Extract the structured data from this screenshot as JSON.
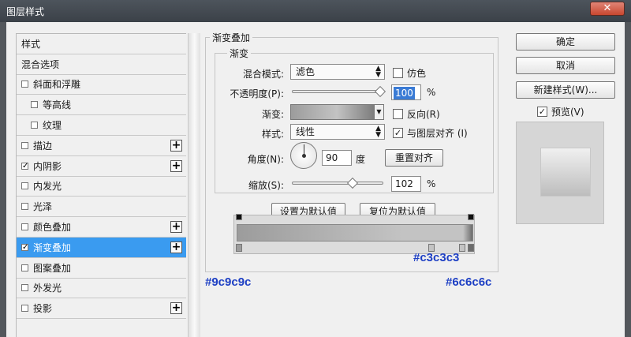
{
  "window": {
    "title": "图层样式",
    "close_label": "✕"
  },
  "left": {
    "items": [
      {
        "label": "样式",
        "checkbox": false,
        "sub": false,
        "plus": false
      },
      {
        "label": "混合选项",
        "checkbox": false,
        "sub": false,
        "plus": false
      },
      {
        "label": "斜面和浮雕",
        "checkbox": true,
        "checked": false,
        "sub": false,
        "plus": false
      },
      {
        "label": "等高线",
        "checkbox": true,
        "checked": false,
        "sub": true,
        "plus": false
      },
      {
        "label": "纹理",
        "checkbox": true,
        "checked": false,
        "sub": true,
        "plus": false
      },
      {
        "label": "描边",
        "checkbox": true,
        "checked": false,
        "sub": false,
        "plus": true
      },
      {
        "label": "内阴影",
        "checkbox": true,
        "checked": true,
        "sub": false,
        "plus": true
      },
      {
        "label": "内发光",
        "checkbox": true,
        "checked": false,
        "sub": false,
        "plus": false
      },
      {
        "label": "光泽",
        "checkbox": true,
        "checked": false,
        "sub": false,
        "plus": false
      },
      {
        "label": "颜色叠加",
        "checkbox": true,
        "checked": false,
        "sub": false,
        "plus": true
      },
      {
        "label": "渐变叠加",
        "checkbox": true,
        "checked": true,
        "sub": false,
        "plus": true,
        "active": true
      },
      {
        "label": "图案叠加",
        "checkbox": true,
        "checked": false,
        "sub": false,
        "plus": false
      },
      {
        "label": "外发光",
        "checkbox": true,
        "checked": false,
        "sub": false,
        "plus": false
      },
      {
        "label": "投影",
        "checkbox": true,
        "checked": false,
        "sub": false,
        "plus": true
      }
    ]
  },
  "main": {
    "group_title": "渐变叠加",
    "subgroup_title": "渐变",
    "blend_mode_label": "混合模式:",
    "blend_mode_value": "滤色",
    "dither_label": "仿色",
    "opacity_label": "不透明度(P):",
    "opacity_value": "100",
    "opacity_percent": 100,
    "percent_sign": "%",
    "gradient_label": "渐变:",
    "reverse_label": "反向(R)",
    "style_label": "样式:",
    "style_value": "线性",
    "align_label": "与图层对齐 (I)",
    "angle_label": "角度(N):",
    "angle_value": "90",
    "degree_label": "度",
    "reset_align_label": "重置对齐",
    "scale_label": "缩放(S):",
    "scale_value": "102",
    "scale_percent": 102,
    "set_default_label": "设置为默认值",
    "reset_default_label": "复位为默认值"
  },
  "right": {
    "ok_label": "确定",
    "cancel_label": "取消",
    "new_style_label": "新建样式(W)...",
    "preview_label": "预览(V)"
  },
  "annotations": {
    "left_color": "#9c9c9c",
    "mid_color": "#c3c3c3",
    "right_color": "#6c6c6c"
  },
  "colors": {
    "accent": "#3a9bf0",
    "annotation": "#1d3fc4"
  }
}
